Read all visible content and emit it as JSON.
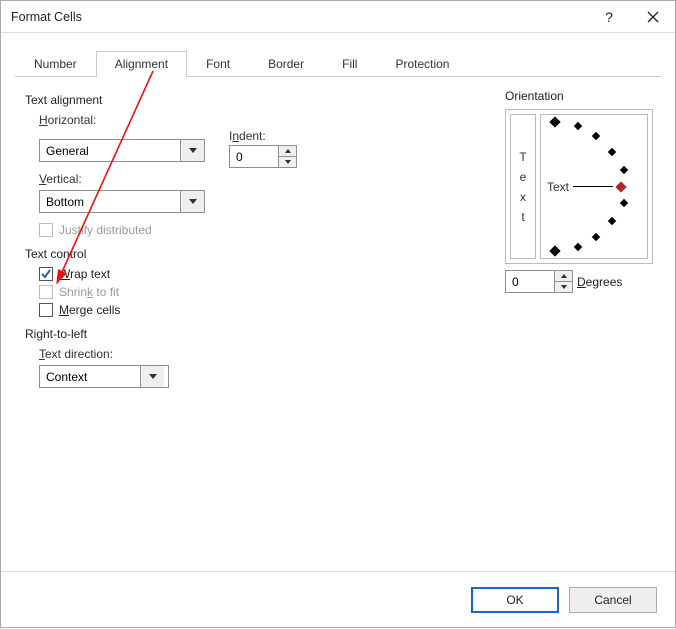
{
  "titlebar": {
    "title": "Format Cells"
  },
  "tabs": {
    "number": "Number",
    "alignment": "Alignment",
    "font": "Font",
    "border": "Border",
    "fill": "Fill",
    "protection": "Protection"
  },
  "text_alignment": {
    "group": "Text alignment",
    "horizontal_label": "Horizontal:",
    "horizontal_value": "General",
    "vertical_label": "Vertical:",
    "vertical_value": "Bottom",
    "indent_label": "Indent:",
    "indent_value": "0",
    "justify_distributed": "Justify distributed"
  },
  "text_control": {
    "group": "Text control",
    "wrap_text": "Wrap text",
    "shrink_to_fit": "Shrink to fit",
    "merge_cells": "Merge cells"
  },
  "rtl": {
    "group": "Right-to-left",
    "text_direction_label": "Text direction:",
    "text_direction_value": "Context"
  },
  "orientation": {
    "group": "Orientation",
    "vertical_letters": [
      "T",
      "e",
      "x",
      "t"
    ],
    "dial_label": "Text",
    "degrees_value": "0",
    "degrees_label": "Degrees"
  },
  "buttons": {
    "ok": "OK",
    "cancel": "Cancel"
  }
}
